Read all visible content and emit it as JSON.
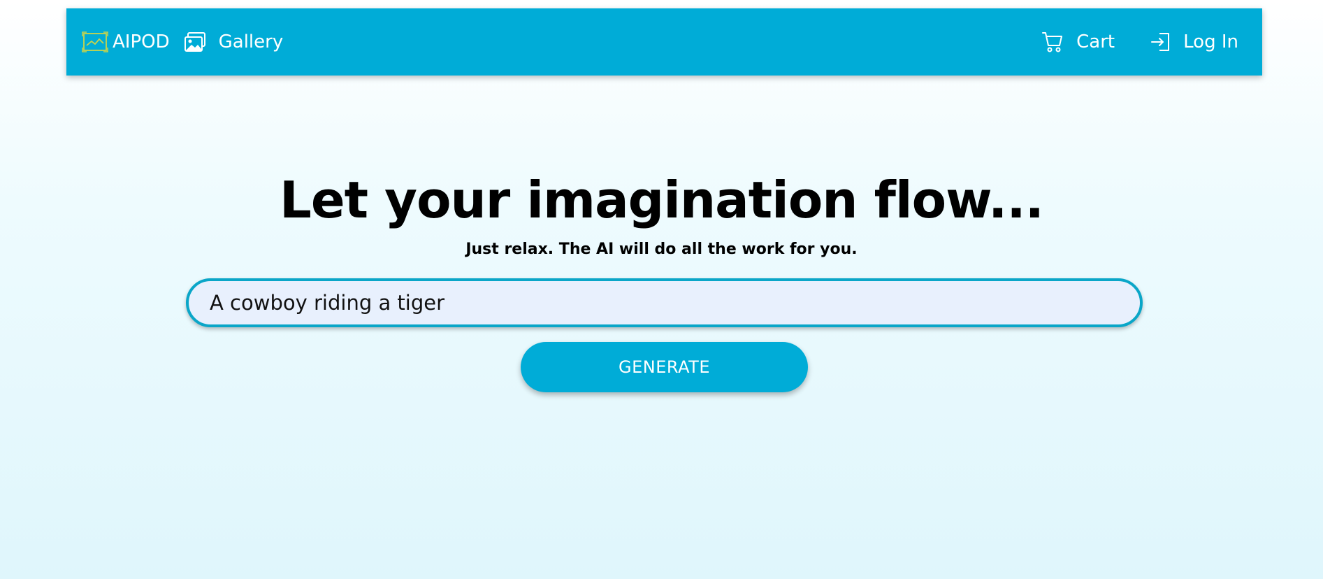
{
  "navbar": {
    "brand": {
      "label": "AIPOD",
      "icon": "landscape-logo-icon",
      "icon_color": "#c9d44a"
    },
    "gallery": {
      "label": "Gallery",
      "icon": "images-icon"
    },
    "cart": {
      "label": "Cart",
      "icon": "cart-icon"
    },
    "login": {
      "label": "Log In",
      "icon": "login-icon"
    },
    "background": "#00acd7"
  },
  "hero": {
    "title": "Let your imagination flow...",
    "subtitle": "Just relax. The AI will do all the work for you."
  },
  "prompt": {
    "value": "A cowboy riding a tiger",
    "border_color": "#0aa6c8"
  },
  "generate_button": {
    "label": "GENERATE",
    "color": "#00acd7"
  }
}
